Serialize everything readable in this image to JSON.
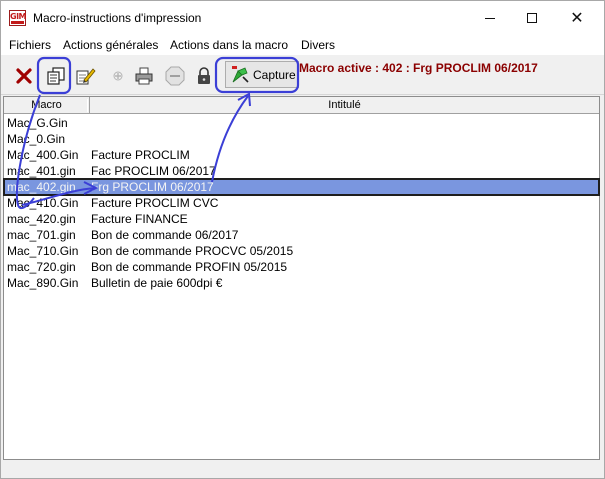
{
  "window": {
    "logo_text": "GIM",
    "title": "Macro-instructions d'impression",
    "close_glyph": "✕"
  },
  "menu": [
    "Fichiers",
    "Actions générales",
    "Actions dans la macro",
    "Divers"
  ],
  "toolbar": {
    "capture_label": "Capture",
    "macro_active": "Macro active : 402 : Frg PROCLIM 06/2017",
    "icons": [
      "delete-icon",
      "copy-pages-icon",
      "edit-pencil-icon",
      "plus-icon",
      "printer-icon",
      "stop-icon",
      "lock-icon",
      "capture-icon"
    ]
  },
  "list": {
    "columns": [
      "Macro",
      "Intitulé"
    ],
    "rows": [
      {
        "macro": "Mac_G.Gin",
        "label": ""
      },
      {
        "macro": "Mac_0.Gin",
        "label": ""
      },
      {
        "macro": "Mac_400.Gin",
        "label": "Facture PROCLIM"
      },
      {
        "macro": "mac_401.gin",
        "label": "Fac PROCLIM 06/2017"
      },
      {
        "macro": "mac_402.gin",
        "label": "Frg PROCLIM 06/2017"
      },
      {
        "macro": "Mac_410.Gin",
        "label": "Facture PROCLIM CVC"
      },
      {
        "macro": "mac_420.gin",
        "label": "Facture FINANCE"
      },
      {
        "macro": "mac_701.gin",
        "label": "Bon de commande 06/2017"
      },
      {
        "macro": "Mac_710.Gin",
        "label": "Bon de commande PROCVC 05/2015"
      },
      {
        "macro": "mac_720.gin",
        "label": "Bon de commande PROFIN 05/2015"
      },
      {
        "macro": "Mac_890.Gin",
        "label": "Bulletin de paie 600dpi €"
      }
    ],
    "selected_index": 4
  },
  "colors": {
    "accent_red": "#8b0000",
    "selection": "#7a96df",
    "annotation": "#3b3fd6"
  }
}
